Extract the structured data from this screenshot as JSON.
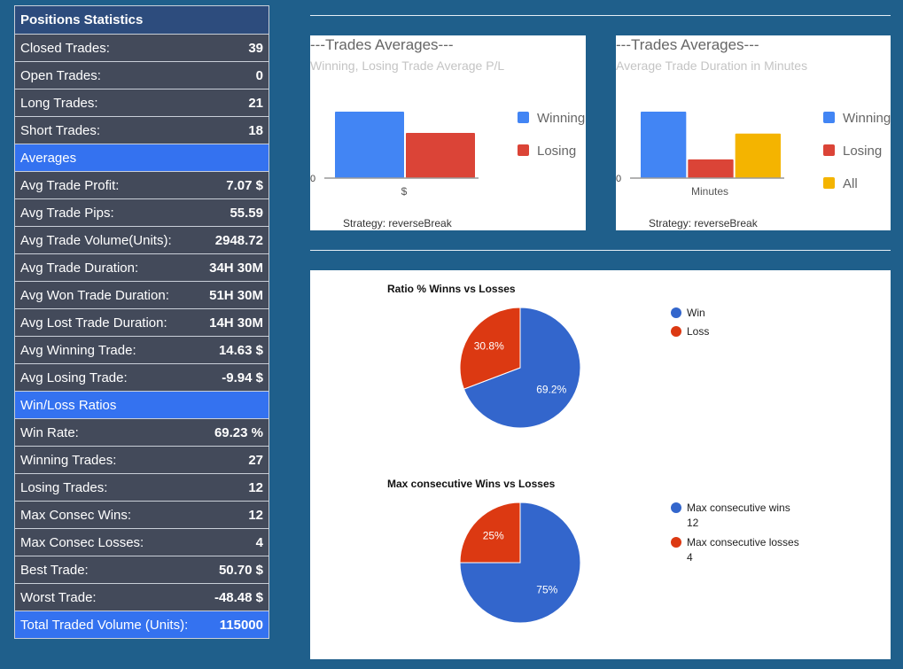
{
  "stats_table": {
    "title": "Positions Statistics",
    "rows": [
      {
        "type": "row",
        "label": "Closed Trades:",
        "value": "39"
      },
      {
        "type": "row",
        "label": "Open Trades:",
        "value": "0"
      },
      {
        "type": "row",
        "label": "Long Trades:",
        "value": "21"
      },
      {
        "type": "row",
        "label": "Short Trades:",
        "value": "18"
      },
      {
        "type": "section",
        "label": "Averages",
        "value": ""
      },
      {
        "type": "row",
        "label": "Avg Trade Profit:",
        "value": "7.07 $"
      },
      {
        "type": "row",
        "label": "Avg Trade Pips:",
        "value": "55.59"
      },
      {
        "type": "row",
        "label": "Avg Trade Volume(Units):",
        "value": "2948.72"
      },
      {
        "type": "row",
        "label": "Avg Trade Duration:",
        "value": "34H 30M"
      },
      {
        "type": "row",
        "label": "Avg Won Trade Duration:",
        "value": "51H 30M"
      },
      {
        "type": "row",
        "label": "Avg Lost Trade Duration:",
        "value": "14H 30M"
      },
      {
        "type": "row",
        "label": "Avg Winning Trade:",
        "value": "14.63 $"
      },
      {
        "type": "row",
        "label": "Avg Losing Trade:",
        "value": "-9.94 $"
      },
      {
        "type": "section",
        "label": "Win/Loss Ratios",
        "value": ""
      },
      {
        "type": "row",
        "label": "Win Rate:",
        "value": "69.23 %"
      },
      {
        "type": "row",
        "label": "Winning Trades:",
        "value": "27"
      },
      {
        "type": "row",
        "label": "Losing Trades:",
        "value": "12"
      },
      {
        "type": "row",
        "label": "Max Consec Wins:",
        "value": "12"
      },
      {
        "type": "row",
        "label": "Max Consec Losses:",
        "value": "4"
      },
      {
        "type": "row",
        "label": "Best Trade:",
        "value": "50.70 $"
      },
      {
        "type": "row",
        "label": "Worst Trade:",
        "value": "-48.48 $"
      },
      {
        "type": "total",
        "label": "Total Traded Volume (Units):",
        "value": "115000"
      }
    ]
  },
  "colors": {
    "blue": "#4285f4",
    "red": "#db4437",
    "yellow": "#f4b400",
    "pie_blue": "#3366cc",
    "pie_red": "#dc3912"
  },
  "chart_data": [
    {
      "type": "bar",
      "title": "---Trades Averages---",
      "subtitle": "Winning, Losing Trade Average P/L",
      "categories": [
        "$"
      ],
      "series": [
        {
          "name": "Winning",
          "values": [
            14.63
          ],
          "color": "#4285f4"
        },
        {
          "name": "Losing",
          "values": [
            9.94
          ],
          "color": "#db4437"
        }
      ],
      "ylim": [
        0,
        14.63
      ],
      "ytick_label": "0",
      "footer": "Strategy: reverseBreak",
      "legend": "right"
    },
    {
      "type": "bar",
      "title": "---Trades Averages---",
      "subtitle": "Average Trade Duration in Minutes",
      "categories": [
        "Minutes"
      ],
      "series": [
        {
          "name": "Winning",
          "values": [
            3090
          ],
          "color": "#4285f4"
        },
        {
          "name": "Losing",
          "values": [
            870
          ],
          "color": "#db4437"
        },
        {
          "name": "All",
          "values": [
            2070
          ],
          "color": "#f4b400"
        }
      ],
      "ylim": [
        0,
        3090
      ],
      "ytick_label": "0",
      "footer": "Strategy: reverseBreak",
      "legend": "right"
    },
    {
      "type": "pie",
      "title": "Ratio % Winns vs Losses",
      "slices": [
        {
          "name": "Win",
          "value": 27,
          "label": "69.2%",
          "color": "#3366cc"
        },
        {
          "name": "Loss",
          "value": 12,
          "label": "30.8%",
          "color": "#dc3912"
        }
      ],
      "legend": "right"
    },
    {
      "type": "pie",
      "title": "Max consecutive Wins vs Losses",
      "slices": [
        {
          "name": "Max consecutive wins",
          "value": 12,
          "label": "75%",
          "legend_value": "12",
          "color": "#3366cc"
        },
        {
          "name": "Max consecutive losses",
          "value": 4,
          "label": "25%",
          "legend_value": "4",
          "color": "#dc3912"
        }
      ],
      "legend": "right"
    }
  ]
}
